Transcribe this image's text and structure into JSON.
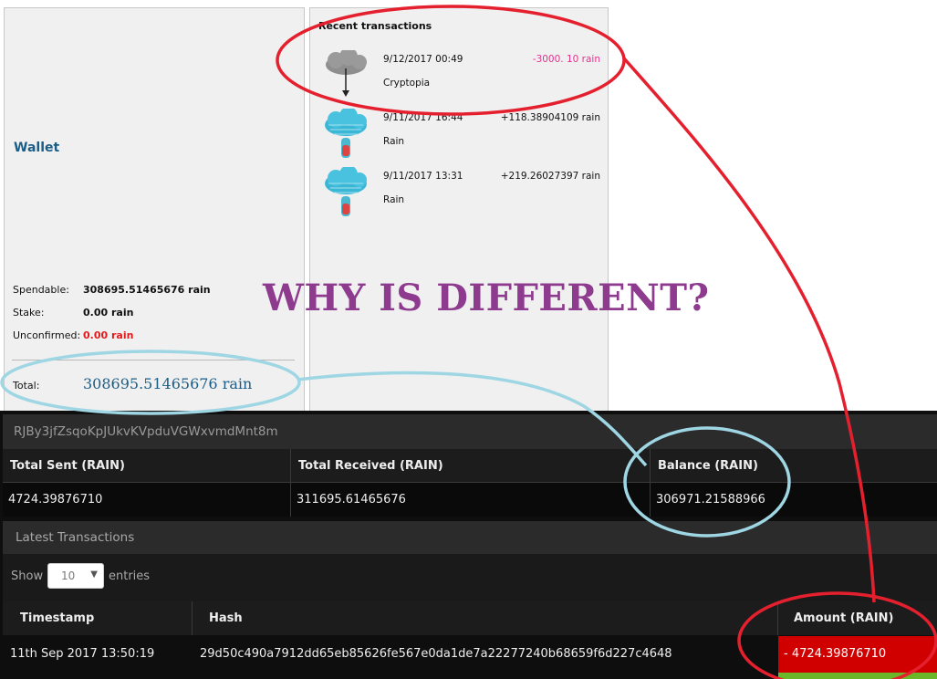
{
  "wallet": {
    "title": "Wallet",
    "rows": [
      {
        "label": "Spendable:",
        "value": "308695.51465676 rain",
        "color": "#111111"
      },
      {
        "label": "Stake:",
        "value": "0.00 rain",
        "color": "#111111"
      },
      {
        "label": "Unconfirmed:",
        "value": "0.00 rain",
        "color": "#e11b1b"
      }
    ],
    "total_label": "Total:",
    "total_value": "308695.51465676 rain"
  },
  "recent": {
    "title": "Recent transactions",
    "items": [
      {
        "date": "9/12/2017 00:49",
        "amount": "-3000. 10 rain",
        "desc": "Cryptopia",
        "icon": "cloud-send-icon",
        "negative": true
      },
      {
        "date": "9/11/2017 16:44",
        "amount": "+118.38904109 rain",
        "desc": "Rain",
        "icon": "cloud-rain-icon",
        "negative": false
      },
      {
        "date": "9/11/2017 13:31",
        "amount": "+219.26027397 rain",
        "desc": "Rain",
        "icon": "cloud-rain-icon",
        "negative": false
      }
    ]
  },
  "overlay_text": "WHY IS DIFFERENT?",
  "explorer": {
    "address": "RJBy3jfZsqoKpJUkvKVpduVGWxvmdMnt8m",
    "summary": {
      "headers": [
        "Total Sent (RAIN)",
        "Total Received (RAIN)",
        "Balance (RAIN)"
      ],
      "values": [
        "4724.39876710",
        "311695.61465676",
        "306971.21588966"
      ]
    },
    "latest_title": "Latest Transactions",
    "show_label": "Show",
    "entries_value": "10",
    "entries_label": "entries",
    "table": {
      "headers": [
        "Timestamp",
        "Hash",
        "Amount (RAIN)"
      ],
      "rows": [
        {
          "timestamp": "11th Sep 2017 13:50:19",
          "hash": "29d50c490a7912dd65eb85626fe567e0da1de7a22277240b68659f6d227c4648",
          "amount": "- 4724.39876710"
        }
      ]
    }
  },
  "colors": {
    "annotation_red": "#e5202e",
    "annotation_blue": "#9fd6e4",
    "amount_negative_bg": "#d10000",
    "amount_positive_strip": "#6ab82a",
    "overlay_text": "#8e3a8e"
  }
}
